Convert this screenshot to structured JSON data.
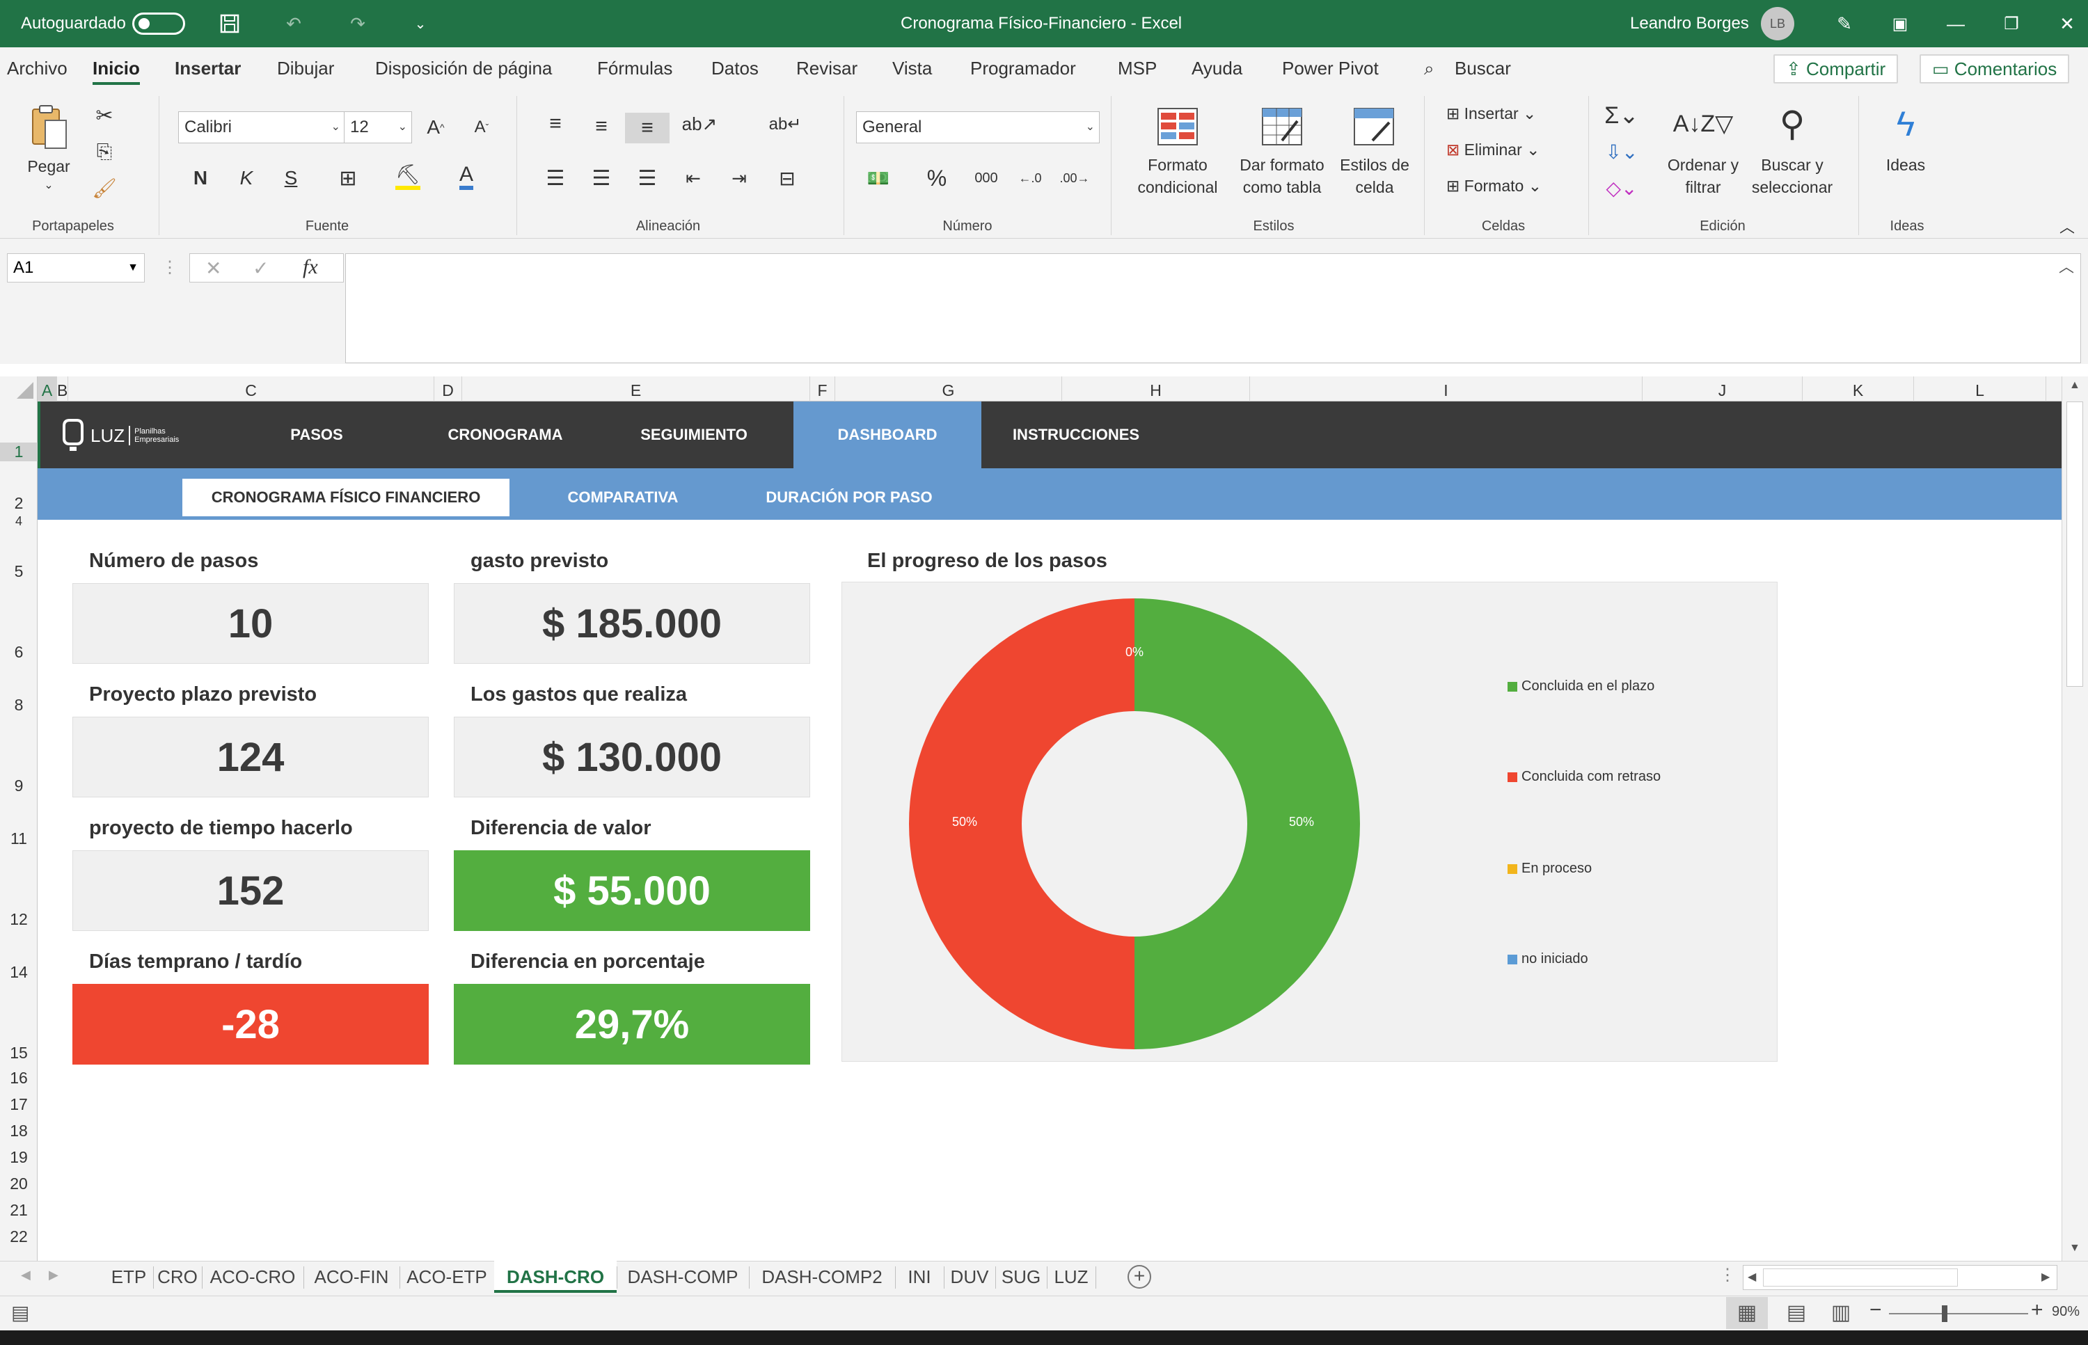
{
  "titlebar": {
    "autosave_label": "Autoguardado",
    "doc_title": "Cronograma Físico-Financiero  -  Excel",
    "user_name": "Leandro Borges",
    "user_initials": "LB"
  },
  "menu": {
    "items": [
      "Archivo",
      "Inicio",
      "Insertar",
      "Dibujar",
      "Disposición de página",
      "Fórmulas",
      "Datos",
      "Revisar",
      "Vista",
      "Programador",
      "MSP",
      "Ayuda",
      "Power Pivot"
    ],
    "search": "Buscar",
    "share": "Compartir",
    "comments": "Comentarios"
  },
  "ribbon": {
    "paste": "Pegar",
    "font_name": "Calibri",
    "font_size": "12",
    "bold": "N",
    "italic": "K",
    "underline": "S",
    "number_format": "General",
    "cond_format_1": "Formato",
    "cond_format_2": "condicional",
    "table_format_1": "Dar formato",
    "table_format_2": "como tabla",
    "cell_styles_1": "Estilos de",
    "cell_styles_2": "celda",
    "insert": "Insertar",
    "delete": "Eliminar",
    "format": "Formato",
    "sort_1": "Ordenar y",
    "sort_2": "filtrar",
    "find_1": "Buscar y",
    "find_2": "seleccionar",
    "ideas": "Ideas",
    "groups": {
      "clipboard": "Portapapeles",
      "font": "Fuente",
      "alignment": "Alineación",
      "number": "Número",
      "styles": "Estilos",
      "cells": "Celdas",
      "editing": "Edición",
      "ideas": "Ideas"
    }
  },
  "formula_bar": {
    "name_box": "A1",
    "fx": "fx",
    "formula": ""
  },
  "grid": {
    "columns": [
      "A",
      "B",
      "C",
      "D",
      "E",
      "F",
      "G",
      "H",
      "I",
      "J",
      "K",
      "L"
    ],
    "rows": [
      "1",
      "2",
      "4",
      "5",
      "6",
      "8",
      "9",
      "11",
      "12",
      "14",
      "15",
      "16",
      "17",
      "18",
      "19",
      "20",
      "21",
      "22"
    ]
  },
  "dashboard": {
    "logo": "LUZ",
    "logo_sub_1": "Planilhas",
    "logo_sub_2": "Empresariais",
    "nav": [
      "PASOS",
      "CRONOGRAMA",
      "SEGUIMIENTO",
      "DASHBOARD",
      "INSTRUCCIONES"
    ],
    "subnav": [
      "CRONOGRAMA FÍSICO FINANCIERO",
      "COMPARATIVA",
      "DURACIÓN POR PASO"
    ],
    "kpis": [
      {
        "label": "Número de pasos",
        "value": "10"
      },
      {
        "label": "gasto previsto",
        "value": "$ 185.000"
      },
      {
        "label": "Proyecto plazo previsto",
        "value": "124"
      },
      {
        "label": "Los gastos que realiza",
        "value": "$ 130.000"
      },
      {
        "label": "proyecto de tiempo hacerlo",
        "value": "152"
      },
      {
        "label": "Diferencia de valor",
        "value": "$ 55.000"
      },
      {
        "label": "Días temprano / tardío",
        "value": "-28"
      },
      {
        "label": "Diferencia en porcentaje",
        "value": "29,7%"
      }
    ],
    "chart_title": "El progreso de los pasos"
  },
  "chart_data": {
    "type": "pie",
    "donut": true,
    "title": "El progreso de los pasos",
    "categories": [
      "Concluida en el plazo",
      "Concluida com retraso",
      "En proceso",
      "no iniciado"
    ],
    "values": [
      50,
      50,
      0,
      0
    ],
    "data_labels": [
      "50%",
      "50%",
      "0%",
      ""
    ],
    "colors": [
      "#53ae3f",
      "#ef4630",
      "#f2b51c",
      "#5b9bd5"
    ],
    "legend_position": "right"
  },
  "sheet_tabs": {
    "tabs": [
      "ETP",
      "CRO",
      "ACO-CRO",
      "ACO-FIN",
      "ACO-ETP",
      "DASH-CRO",
      "DASH-COMP",
      "DASH-COMP2",
      "INI",
      "DUV",
      "SUG",
      "LUZ"
    ],
    "active": "DASH-CRO"
  },
  "status": {
    "zoom": "90%"
  },
  "colors": {
    "excel_green": "#217346",
    "nav_dark": "#3a3a3a",
    "nav_blue": "#6599cf",
    "kpi_green": "#53ae3f",
    "kpi_red": "#ef4630"
  }
}
